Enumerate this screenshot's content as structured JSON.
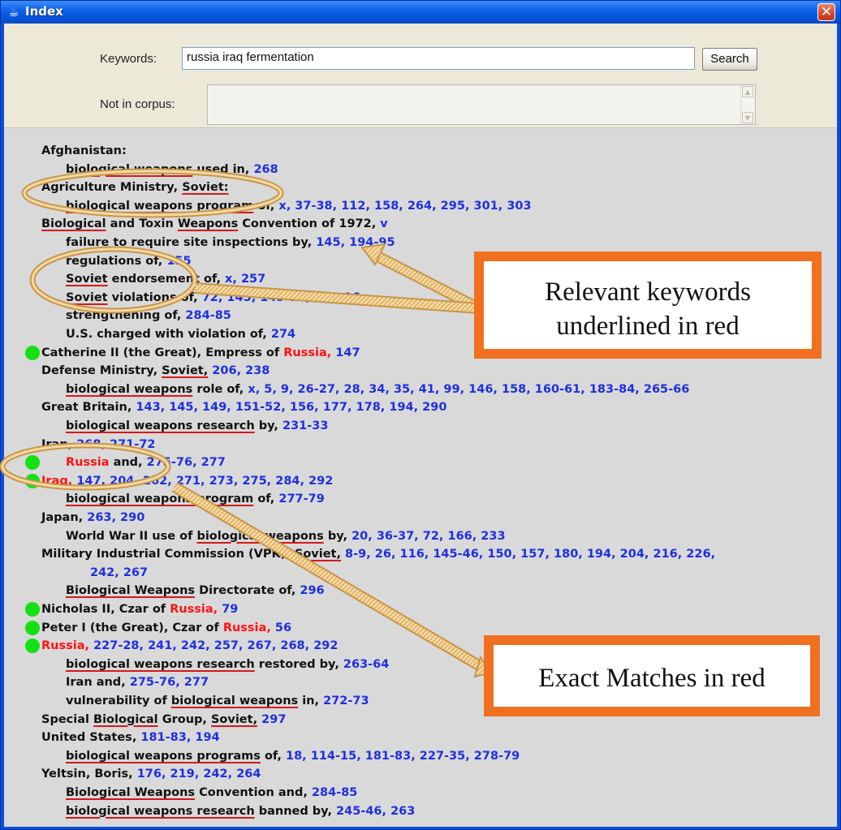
{
  "window": {
    "title": "Index",
    "close_glyph": "✕",
    "app_icon": "java-cup-icon"
  },
  "search": {
    "keywords_label": "Keywords:",
    "keywords_value": "russia iraq fermentation",
    "search_button": "Search",
    "not_in_corpus_label": "Not in corpus:",
    "not_in_corpus_value": ""
  },
  "entries": [
    {
      "indent": 0,
      "dot": false,
      "segments": [
        {
          "t": "Afghanistan:",
          "s": "n"
        }
      ]
    },
    {
      "indent": 1,
      "dot": false,
      "segments": [
        {
          "t": "biological weapons",
          "s": "u"
        },
        {
          "t": " used in, ",
          "s": "n"
        },
        {
          "t": "268",
          "s": "p"
        }
      ]
    },
    {
      "indent": 0,
      "dot": false,
      "segments": [
        {
          "t": "Agriculture Ministry, ",
          "s": "n"
        },
        {
          "t": "Soviet:",
          "s": "u"
        }
      ]
    },
    {
      "indent": 1,
      "dot": false,
      "segments": [
        {
          "t": "biological weapons program",
          "s": "u"
        },
        {
          "t": " of, ",
          "s": "n"
        },
        {
          "t": "x, 37-38, 112, 158, 264, 295, 301, 303",
          "s": "p"
        }
      ]
    },
    {
      "indent": 0,
      "dot": false,
      "segments": [
        {
          "t": "Biological",
          "s": "u"
        },
        {
          "t": " and Toxin ",
          "s": "n"
        },
        {
          "t": "Weapons",
          "s": "u"
        },
        {
          "t": " Convention of 1972, ",
          "s": "n"
        },
        {
          "t": "v",
          "s": "p"
        }
      ]
    },
    {
      "indent": 1,
      "dot": false,
      "segments": [
        {
          "t": "failure to require site inspections by, ",
          "s": "n"
        },
        {
          "t": "145, 194-95",
          "s": "p"
        }
      ]
    },
    {
      "indent": 1,
      "dot": false,
      "segments": [
        {
          "t": "regulations of, ",
          "s": "n"
        },
        {
          "t": "155",
          "s": "p"
        }
      ]
    },
    {
      "indent": 1,
      "dot": false,
      "segments": [
        {
          "t": "Soviet",
          "s": "u"
        },
        {
          "t": " endorsement of, ",
          "s": "n"
        },
        {
          "t": "x, 257",
          "s": "p"
        }
      ]
    },
    {
      "indent": 1,
      "dot": false,
      "segments": [
        {
          "t": "Soviet",
          "s": "u"
        },
        {
          "t": " violations of, ",
          "s": "n"
        },
        {
          "t": "72, 145, 149-50, 194-96",
          "s": "p"
        }
      ]
    },
    {
      "indent": 1,
      "dot": false,
      "segments": [
        {
          "t": "strengthening of, ",
          "s": "n"
        },
        {
          "t": "284-85",
          "s": "p"
        }
      ]
    },
    {
      "indent": 1,
      "dot": false,
      "segments": [
        {
          "t": "U.S. charged with violation of, ",
          "s": "n"
        },
        {
          "t": "274",
          "s": "p"
        }
      ]
    },
    {
      "indent": 0,
      "dot": true,
      "segments": [
        {
          "t": "Catherine II (the Great), Empress of ",
          "s": "n"
        },
        {
          "t": "Russia, ",
          "s": "e"
        },
        {
          "t": "147",
          "s": "p"
        }
      ]
    },
    {
      "indent": 0,
      "dot": false,
      "segments": [
        {
          "t": "Defense Ministry, ",
          "s": "n"
        },
        {
          "t": "Soviet,",
          "s": "u"
        },
        {
          "t": " 206, 238",
          "s": "p"
        }
      ]
    },
    {
      "indent": 1,
      "dot": false,
      "segments": [
        {
          "t": "biological weapons",
          "s": "u"
        },
        {
          "t": " role of, ",
          "s": "n"
        },
        {
          "t": "x, 5, 9, 26-27, 28, 34, 35, 41, 99, 146, 158, 160-61, 183-84, 265-66",
          "s": "p"
        }
      ]
    },
    {
      "indent": 0,
      "dot": false,
      "segments": [
        {
          "t": "Great Britain, ",
          "s": "n"
        },
        {
          "t": "143, 145, 149, 151-52, 156, 177, 178, 194, 290",
          "s": "p"
        }
      ]
    },
    {
      "indent": 1,
      "dot": false,
      "segments": [
        {
          "t": "biological weapons research",
          "s": "u"
        },
        {
          "t": " by, ",
          "s": "n"
        },
        {
          "t": "231-33",
          "s": "p"
        }
      ]
    },
    {
      "indent": 0,
      "dot": false,
      "segments": [
        {
          "t": "Iran, ",
          "s": "n"
        },
        {
          "t": "268, 271-72",
          "s": "p"
        }
      ]
    },
    {
      "indent": 1,
      "dot": true,
      "segments": [
        {
          "t": "Russia",
          "s": "e"
        },
        {
          "t": " and, ",
          "s": "n"
        },
        {
          "t": "275-76, 277",
          "s": "p"
        }
      ]
    },
    {
      "indent": 0,
      "dot": true,
      "segments": [
        {
          "t": "Iraq, ",
          "s": "e"
        },
        {
          "t": "147, 204, 262, 271, 273, 275, 284, 292",
          "s": "p"
        }
      ]
    },
    {
      "indent": 1,
      "dot": false,
      "segments": [
        {
          "t": "biological weapons program",
          "s": "u"
        },
        {
          "t": " of, ",
          "s": "n"
        },
        {
          "t": "277-79",
          "s": "p"
        }
      ]
    },
    {
      "indent": 0,
      "dot": false,
      "segments": [
        {
          "t": "Japan, ",
          "s": "n"
        },
        {
          "t": "263, 290",
          "s": "p"
        }
      ]
    },
    {
      "indent": 1,
      "dot": false,
      "segments": [
        {
          "t": "World War II use of ",
          "s": "n"
        },
        {
          "t": "biological weapons",
          "s": "u"
        },
        {
          "t": " by, ",
          "s": "n"
        },
        {
          "t": "20, 36-37, 72, 166, 233",
          "s": "p"
        }
      ]
    },
    {
      "indent": 0,
      "dot": false,
      "segments": [
        {
          "t": "Military Industrial Commission (VPK), ",
          "s": "n"
        },
        {
          "t": "Soviet,",
          "s": "u"
        },
        {
          "t": " 8-9, 26, 116, 145-46, 150, 157, 180, 194, 204, 216, 226,",
          "s": "p"
        }
      ]
    },
    {
      "indent": 2,
      "dot": false,
      "segments": [
        {
          "t": "242, 267",
          "s": "p"
        }
      ]
    },
    {
      "indent": 1,
      "dot": false,
      "segments": [
        {
          "t": "Biological Weapons",
          "s": "u"
        },
        {
          "t": " Directorate of, ",
          "s": "n"
        },
        {
          "t": "296",
          "s": "p"
        }
      ]
    },
    {
      "indent": 0,
      "dot": true,
      "segments": [
        {
          "t": "Nicholas II, Czar of ",
          "s": "n"
        },
        {
          "t": "Russia, ",
          "s": "e"
        },
        {
          "t": "79",
          "s": "p"
        }
      ]
    },
    {
      "indent": 0,
      "dot": true,
      "segments": [
        {
          "t": "Peter I (the Great), Czar of ",
          "s": "n"
        },
        {
          "t": "Russia, ",
          "s": "e"
        },
        {
          "t": "56",
          "s": "p"
        }
      ]
    },
    {
      "indent": 0,
      "dot": true,
      "segments": [
        {
          "t": "Russia, ",
          "s": "e"
        },
        {
          "t": "227-28, 241, 242, 257, 267, 268, 292",
          "s": "p"
        }
      ]
    },
    {
      "indent": 1,
      "dot": false,
      "segments": [
        {
          "t": "biological weapons research",
          "s": "u"
        },
        {
          "t": " restored by, ",
          "s": "n"
        },
        {
          "t": "263-64",
          "s": "p"
        }
      ]
    },
    {
      "indent": 1,
      "dot": false,
      "segments": [
        {
          "t": "Iran and, ",
          "s": "n"
        },
        {
          "t": "275-76, 277",
          "s": "p"
        }
      ]
    },
    {
      "indent": 1,
      "dot": false,
      "segments": [
        {
          "t": "vulnerability of ",
          "s": "n"
        },
        {
          "t": "biological weapons",
          "s": "u"
        },
        {
          "t": " in, ",
          "s": "n"
        },
        {
          "t": "272-73",
          "s": "p"
        }
      ]
    },
    {
      "indent": 0,
      "dot": false,
      "segments": [
        {
          "t": "Special ",
          "s": "n"
        },
        {
          "t": "Biological",
          "s": "u"
        },
        {
          "t": " Group, ",
          "s": "n"
        },
        {
          "t": "Soviet,",
          "s": "u"
        },
        {
          "t": " 297",
          "s": "p"
        }
      ]
    },
    {
      "indent": 0,
      "dot": false,
      "segments": [
        {
          "t": "United States, ",
          "s": "n"
        },
        {
          "t": "181-83, 194",
          "s": "p"
        }
      ]
    },
    {
      "indent": 1,
      "dot": false,
      "segments": [
        {
          "t": "biological weapons programs",
          "s": "u"
        },
        {
          "t": " of, ",
          "s": "n"
        },
        {
          "t": "18, 114-15, 181-83, 227-35, 278-79",
          "s": "p"
        }
      ]
    },
    {
      "indent": 0,
      "dot": false,
      "segments": [
        {
          "t": "Yeltsin, Boris, ",
          "s": "n"
        },
        {
          "t": "176, 219, 242, 264",
          "s": "p"
        }
      ]
    },
    {
      "indent": 1,
      "dot": false,
      "segments": [
        {
          "t": "Biological Weapons",
          "s": "u"
        },
        {
          "t": " Convention and, ",
          "s": "n"
        },
        {
          "t": "284-85",
          "s": "p"
        }
      ]
    },
    {
      "indent": 1,
      "dot": false,
      "segments": [
        {
          "t": "biological weapons research",
          "s": "u"
        },
        {
          "t": " banned by, ",
          "s": "n"
        },
        {
          "t": "245-46, 263",
          "s": "p"
        }
      ]
    }
  ],
  "colors": {
    "page_number": "#1f2fdf",
    "exact_match": "#ff1212",
    "underline": "#d21a1a",
    "match_dot": "#14e014",
    "callout_border": "#f07020",
    "arrow_fill": "#e6b96a"
  },
  "annotations": {
    "callout_keywords": {
      "line1": "Relevant keywords",
      "line2": "underlined in red"
    },
    "callout_exact": {
      "text": "Exact Matches in red"
    }
  }
}
